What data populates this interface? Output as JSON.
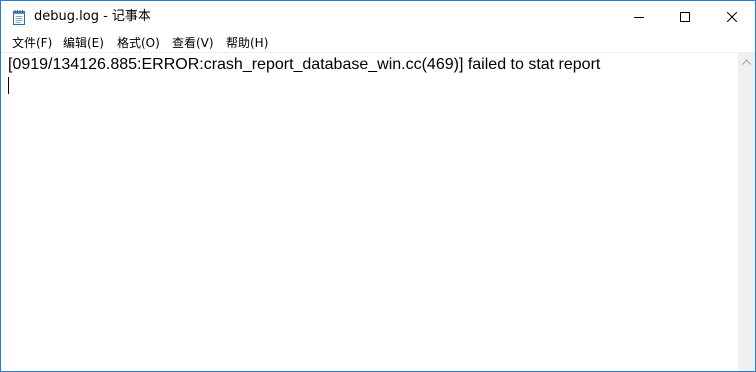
{
  "window": {
    "title": "debug.log - 记事本",
    "icons": {
      "app": "notepad-icon",
      "minimize": "minimize-icon",
      "maximize": "maximize-icon",
      "close": "close-icon"
    },
    "border_color": "#1f7fd8"
  },
  "menu": {
    "items": [
      {
        "label": "文件(F)"
      },
      {
        "label": "编辑(E)"
      },
      {
        "label": "格式(O)"
      },
      {
        "label": "查看(V)"
      },
      {
        "label": "帮助(H)"
      }
    ]
  },
  "editor": {
    "content": "[0919/134126.885:ERROR:crash_report_database_win.cc(469)] failed to stat report"
  },
  "scrollbar": {
    "up_icon": "scroll-up-arrow-icon"
  }
}
